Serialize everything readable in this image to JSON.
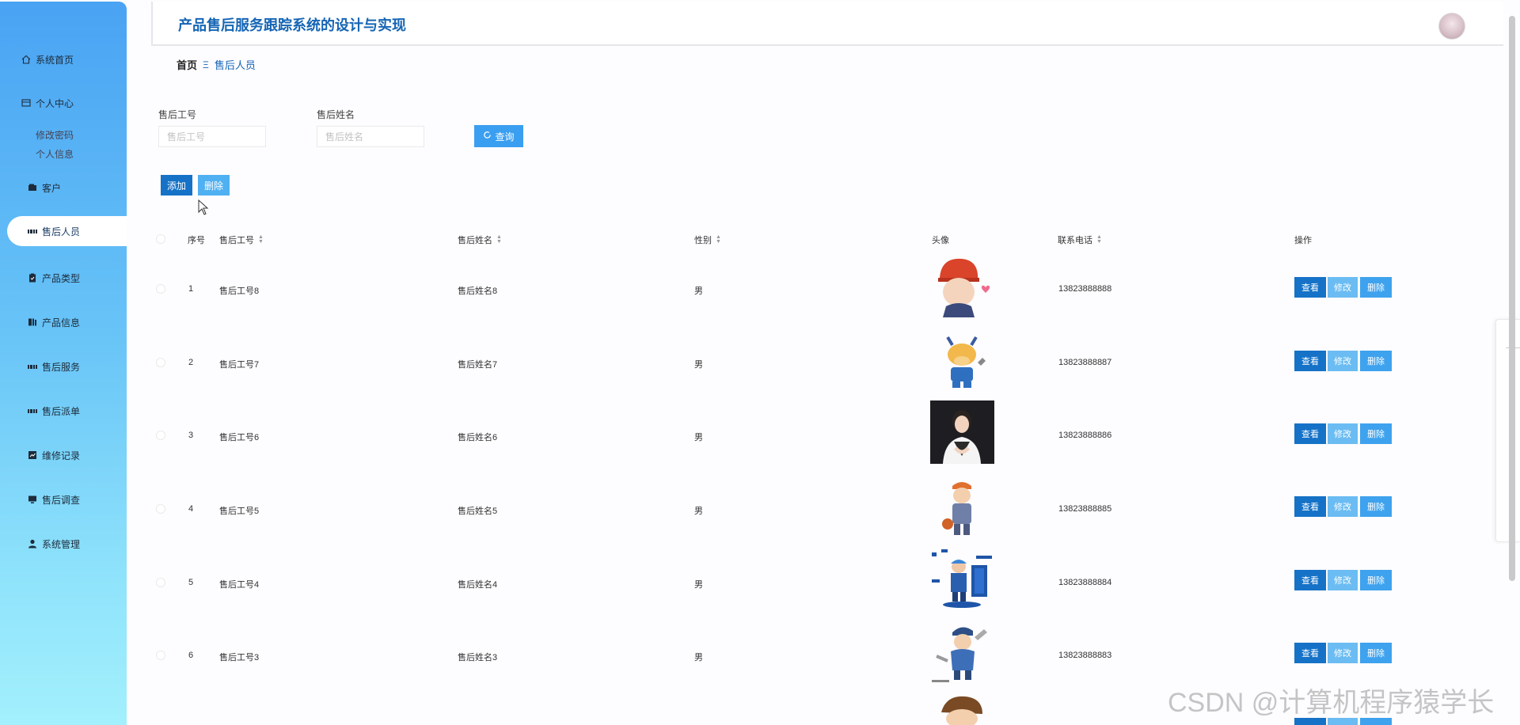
{
  "header": {
    "title": "产品售后服务跟踪系统的设计与实现"
  },
  "sidebar": {
    "home": "系统首页",
    "personal": "个人中心",
    "personal_sub": [
      "修改密码",
      "个人信息"
    ],
    "items": [
      {
        "label": "客户",
        "icon": "wallet-icon"
      },
      {
        "label": "售后人员",
        "icon": "grid-icon",
        "active": true
      },
      {
        "label": "产品类型",
        "icon": "clipboard-icon"
      },
      {
        "label": "产品信息",
        "icon": "book-icon"
      },
      {
        "label": "售后服务",
        "icon": "grid-icon"
      },
      {
        "label": "售后派单",
        "icon": "grid-icon"
      },
      {
        "label": "维修记录",
        "icon": "chart-icon"
      },
      {
        "label": "售后调查",
        "icon": "monitor-icon"
      },
      {
        "label": "系统管理",
        "icon": "user-icon"
      }
    ]
  },
  "breadcrumb": {
    "home": "首页",
    "separator": "Ξ",
    "current": "售后人员"
  },
  "search": {
    "field1_label": "售后工号",
    "field1_placeholder": "售后工号",
    "field2_label": "售后姓名",
    "field2_placeholder": "售后姓名",
    "query_button": "查询"
  },
  "actions": {
    "add": "添加",
    "delete": "删除"
  },
  "table": {
    "columns": [
      "序号",
      "售后工号",
      "售后姓名",
      "性别",
      "头像",
      "联系电话",
      "操作"
    ],
    "rows": [
      {
        "index": "1",
        "id": "售后工号8",
        "name": "售后姓名8",
        "gender": "男",
        "phone": "13823888888"
      },
      {
        "index": "2",
        "id": "售后工号7",
        "name": "售后姓名7",
        "gender": "男",
        "phone": "13823888887"
      },
      {
        "index": "3",
        "id": "售后工号6",
        "name": "售后姓名6",
        "gender": "男",
        "phone": "13823888886"
      },
      {
        "index": "4",
        "id": "售后工号5",
        "name": "售后姓名5",
        "gender": "男",
        "phone": "13823888885"
      },
      {
        "index": "5",
        "id": "售后工号4",
        "name": "售后姓名4",
        "gender": "男",
        "phone": "13823888884"
      },
      {
        "index": "6",
        "id": "售后工号3",
        "name": "售后姓名3",
        "gender": "男",
        "phone": "13823888883"
      }
    ],
    "row_buttons": {
      "view": "查看",
      "edit": "修改",
      "delete": "删除"
    }
  },
  "watermark": "CSDN @计算机程序猿学长",
  "colors": {
    "primary": "#1572c7",
    "accent": "#3a9ff0",
    "title": "#1565b5"
  }
}
